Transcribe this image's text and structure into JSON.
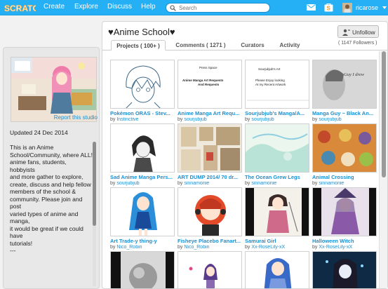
{
  "nav": {
    "logo_text": "SCRATCH",
    "links": [
      "Create",
      "Explore",
      "Discuss",
      "Help"
    ],
    "search_placeholder": "Search",
    "username": "ricarose"
  },
  "sidebar": {
    "report_label": "Report this studio",
    "updated": "Updated 24 Dec 2014",
    "description_lines": [
      "This is an Anime",
      "School/Community, where ALL!",
      "anime fans, students, hobbyists",
      "and more gather to explore,",
      "create, discuss and help fellow",
      "members of the school &",
      "community. Please join and post",
      "varied types of anime and manga,",
      "it would be great if we could have",
      "tutorials!",
      "---"
    ]
  },
  "studio": {
    "title": "♥Anime School♥",
    "unfollow_label": "Unfollow",
    "followers": "( 1147 Followers )",
    "tabs": [
      "Projects ( 100+ )",
      "Comments ( 1271 )",
      "Curators",
      "Activity"
    ]
  },
  "projects": [
    {
      "title": "Pokémon ORAS - Stev...",
      "by": "by",
      "author": "Instinctive"
    },
    {
      "title": "Anime Manga Art Requ...",
      "by": "by",
      "author": "sourjubjub"
    },
    {
      "title": "Sourjubjub's Manga/A...",
      "by": "by",
      "author": "sourjubjub"
    },
    {
      "title": "Manga Guy ~ Black An...",
      "by": "by",
      "author": "sourjubjub"
    },
    {
      "title": "Sad Anime Manga Pers...",
      "by": "by",
      "author": "sourjubjub"
    },
    {
      "title": "ART DUMP 2014/ 70 dr...",
      "by": "by",
      "author": "sinnamonie"
    },
    {
      "title": "The Ocean Grew Legs",
      "by": "by",
      "author": "sinnamonie"
    },
    {
      "title": "Animal Crossing",
      "by": "by",
      "author": "sinnamonie"
    },
    {
      "title": "Art Trade-y thing-y",
      "by": "by",
      "author": "Nico_Robin"
    },
    {
      "title": "Fisheye Placebo Fanart...",
      "by": "by",
      "author": "Nico_Robin"
    },
    {
      "title": "Samurai Girl",
      "by": "by",
      "author": "Xx-RoseLily-xX"
    },
    {
      "title": "Halloween Witch",
      "by": "by",
      "author": "Xx-RoseLily-xX"
    },
    {
      "title": "",
      "by": "",
      "author": ""
    },
    {
      "title": "",
      "by": "",
      "author": ""
    },
    {
      "title": "",
      "by": "",
      "author": ""
    },
    {
      "title": "",
      "by": "",
      "author": ""
    }
  ],
  "thumb_texts": {
    "t2": [
      "Press Space",
      "Anime Manga Art Requests",
      "And Requests"
    ],
    "t3": [
      "Sourjubjub's Art",
      "Please Enjoy looking",
      "At my Recent Artwork"
    ],
    "t4": [
      "Guy I drew"
    ]
  },
  "colors": {
    "nav_blue": "#25aff4",
    "link_blue": "#1b8fd1",
    "orange_notice": "#f7941d"
  }
}
